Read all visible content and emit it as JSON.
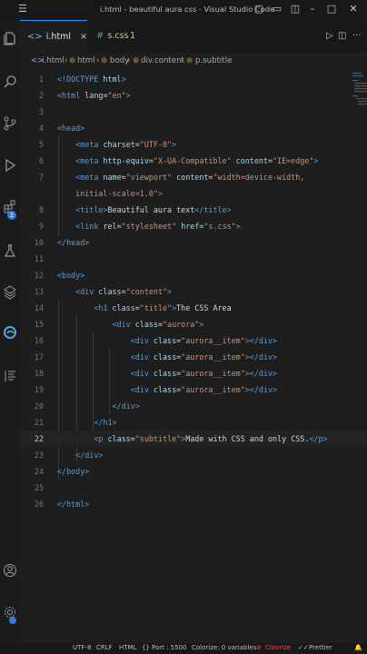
{
  "window": {
    "title": "i.html - beautiful aura css - Visual Studio Code",
    "menu_icon": "hamburger-icon",
    "buttons": [
      "layout-sidebar-icon",
      "layout-panel-icon",
      "layout-split-icon",
      "minimize-icon",
      "maximize-icon",
      "close-icon"
    ]
  },
  "activity_bar": {
    "items": [
      "explorer-icon",
      "search-icon",
      "source-control-icon",
      "run-debug-icon",
      "extensions-icon",
      "testing-icon",
      "remote-explorer-icon",
      "edge-icon",
      "outline-icon"
    ],
    "extensions_badge": "1",
    "bottom": [
      "account-icon",
      "settings-icon"
    ]
  },
  "tabs": [
    {
      "icon": "<>",
      "label": "i.html",
      "close": "×"
    },
    {
      "icon": "#",
      "label": "s.css",
      "count": "1"
    }
  ],
  "editor_actions": {
    "run": "▷",
    "split": "◫",
    "more": "···"
  },
  "breadcrumb": [
    "i.html",
    "html",
    "body",
    "div.content",
    "p.subtitle"
  ],
  "code_lines": [
    {
      "n": "1",
      "t": [
        [
          "tg",
          "<!DOCTYPE "
        ],
        [
          "at",
          "html"
        ],
        [
          "tg",
          ">"
        ]
      ]
    },
    {
      "n": "2",
      "t": [
        [
          "tg",
          "<html "
        ],
        [
          "at",
          "lang"
        ],
        [
          "tx",
          "="
        ],
        [
          "vl",
          "\"en\""
        ],
        [
          "tg",
          ">"
        ]
      ]
    },
    {
      "n": "3",
      "t": []
    },
    {
      "n": "4",
      "t": [
        [
          "tg",
          "<head>"
        ]
      ]
    },
    {
      "n": "5",
      "t": [
        [
          "tx",
          "    "
        ],
        [
          "tg",
          "<meta "
        ],
        [
          "at",
          "charset"
        ],
        [
          "tx",
          "="
        ],
        [
          "vl",
          "\"UTF-8\""
        ],
        [
          "tg",
          ">"
        ]
      ]
    },
    {
      "n": "6",
      "t": [
        [
          "tx",
          "    "
        ],
        [
          "tg",
          "<meta "
        ],
        [
          "at",
          "http-equiv"
        ],
        [
          "tx",
          "="
        ],
        [
          "vl",
          "\"X-UA-Compatible\""
        ],
        [
          "tx",
          " "
        ],
        [
          "at",
          "content"
        ],
        [
          "tx",
          "="
        ],
        [
          "vl",
          "\"IE=edge\""
        ],
        [
          "tg",
          ">"
        ]
      ]
    },
    {
      "n": "7",
      "t": [
        [
          "tx",
          "    "
        ],
        [
          "tg",
          "<meta "
        ],
        [
          "at",
          "name"
        ],
        [
          "tx",
          "="
        ],
        [
          "vl",
          "\"viewport\""
        ],
        [
          "tx",
          " "
        ],
        [
          "at",
          "content"
        ],
        [
          "tx",
          "="
        ],
        [
          "vl",
          "\"width=device-width,"
        ]
      ]
    },
    {
      "n": "",
      "t": [
        [
          "vl",
          "    initial-scale=1.0\""
        ],
        [
          "tg",
          ">"
        ]
      ]
    },
    {
      "n": "8",
      "t": [
        [
          "tx",
          "    "
        ],
        [
          "tg",
          "<title>"
        ],
        [
          "tx",
          "Beautiful aura text"
        ],
        [
          "tg",
          "</title>"
        ]
      ]
    },
    {
      "n": "9",
      "t": [
        [
          "tx",
          "    "
        ],
        [
          "tg",
          "<link "
        ],
        [
          "at",
          "rel"
        ],
        [
          "tx",
          "="
        ],
        [
          "vl",
          "\"stylesheet\""
        ],
        [
          "tx",
          " "
        ],
        [
          "at",
          "href"
        ],
        [
          "tx",
          "="
        ],
        [
          "vl",
          "\"s.css\""
        ],
        [
          "tg",
          ">"
        ]
      ]
    },
    {
      "n": "10",
      "t": [
        [
          "tg",
          "</head>"
        ]
      ]
    },
    {
      "n": "11",
      "t": []
    },
    {
      "n": "12",
      "t": [
        [
          "tg",
          "<body>"
        ]
      ]
    },
    {
      "n": "13",
      "t": [
        [
          "tx",
          "    "
        ],
        [
          "tg",
          "<div "
        ],
        [
          "at",
          "class"
        ],
        [
          "tx",
          "="
        ],
        [
          "vl",
          "\"content\""
        ],
        [
          "tg",
          ">"
        ]
      ]
    },
    {
      "n": "14",
      "t": [
        [
          "tx",
          "        "
        ],
        [
          "tg",
          "<h1 "
        ],
        [
          "at",
          "class"
        ],
        [
          "tx",
          "="
        ],
        [
          "vl",
          "\"title\""
        ],
        [
          "tg",
          ">"
        ],
        [
          "tx",
          "The CSS Area"
        ]
      ]
    },
    {
      "n": "15",
      "t": [
        [
          "tx",
          "            "
        ],
        [
          "tg",
          "<div "
        ],
        [
          "at",
          "class"
        ],
        [
          "tx",
          "="
        ],
        [
          "vl",
          "\"aurora\""
        ],
        [
          "tg",
          ">"
        ]
      ]
    },
    {
      "n": "16",
      "t": [
        [
          "tx",
          "                "
        ],
        [
          "tg",
          "<div "
        ],
        [
          "at",
          "class"
        ],
        [
          "tx",
          "="
        ],
        [
          "vl",
          "\"aurora__item\""
        ],
        [
          "tg",
          "></div>"
        ]
      ]
    },
    {
      "n": "17",
      "t": [
        [
          "tx",
          "                "
        ],
        [
          "tg",
          "<div "
        ],
        [
          "at",
          "class"
        ],
        [
          "tx",
          "="
        ],
        [
          "vl",
          "\"aurora__item\""
        ],
        [
          "tg",
          "></div>"
        ]
      ]
    },
    {
      "n": "18",
      "t": [
        [
          "tx",
          "                "
        ],
        [
          "tg",
          "<div "
        ],
        [
          "at",
          "class"
        ],
        [
          "tx",
          "="
        ],
        [
          "vl",
          "\"aurora__item\""
        ],
        [
          "tg",
          "></div>"
        ]
      ]
    },
    {
      "n": "19",
      "t": [
        [
          "tx",
          "                "
        ],
        [
          "tg",
          "<div "
        ],
        [
          "at",
          "class"
        ],
        [
          "tx",
          "="
        ],
        [
          "vl",
          "\"aurora__item\""
        ],
        [
          "tg",
          "></div>"
        ]
      ]
    },
    {
      "n": "20",
      "t": [
        [
          "tx",
          "            "
        ],
        [
          "tg",
          "</div>"
        ]
      ]
    },
    {
      "n": "21",
      "t": [
        [
          "tx",
          "        "
        ],
        [
          "tg",
          "</h1>"
        ]
      ]
    },
    {
      "n": "22",
      "t": [
        [
          "tx",
          "        "
        ],
        [
          "tg",
          "<p "
        ],
        [
          "at",
          "class"
        ],
        [
          "tx",
          "="
        ],
        [
          "vl",
          "\"subtitle\""
        ],
        [
          "tg",
          ">"
        ],
        [
          "tx",
          "Made with CSS and only CSS."
        ],
        [
          "tg",
          "</p>"
        ]
      ]
    },
    {
      "n": "23",
      "t": [
        [
          "tx",
          "    "
        ],
        [
          "tg",
          "</div>"
        ]
      ]
    },
    {
      "n": "24",
      "t": [
        [
          "tg",
          "</body>"
        ]
      ]
    },
    {
      "n": "25",
      "t": []
    },
    {
      "n": "26",
      "t": [
        [
          "tg",
          "</html>"
        ]
      ]
    }
  ],
  "current_line": "22",
  "status_bar": {
    "encoding": "UTF-8",
    "eol": "CRLF",
    "language": "HTML",
    "port": "Port : 5500",
    "colorize_vars": "Colorize: 0 variables",
    "colorize": "Colorize",
    "prettier": "Prettier"
  },
  "colors": {
    "accent": "#3794ff",
    "tag": "#569cd6",
    "attr": "#9cdcfe",
    "value": "#ce9178",
    "text": "#d4d4d4",
    "css_tab": "#e2c08d",
    "error": "#f14c4c"
  }
}
